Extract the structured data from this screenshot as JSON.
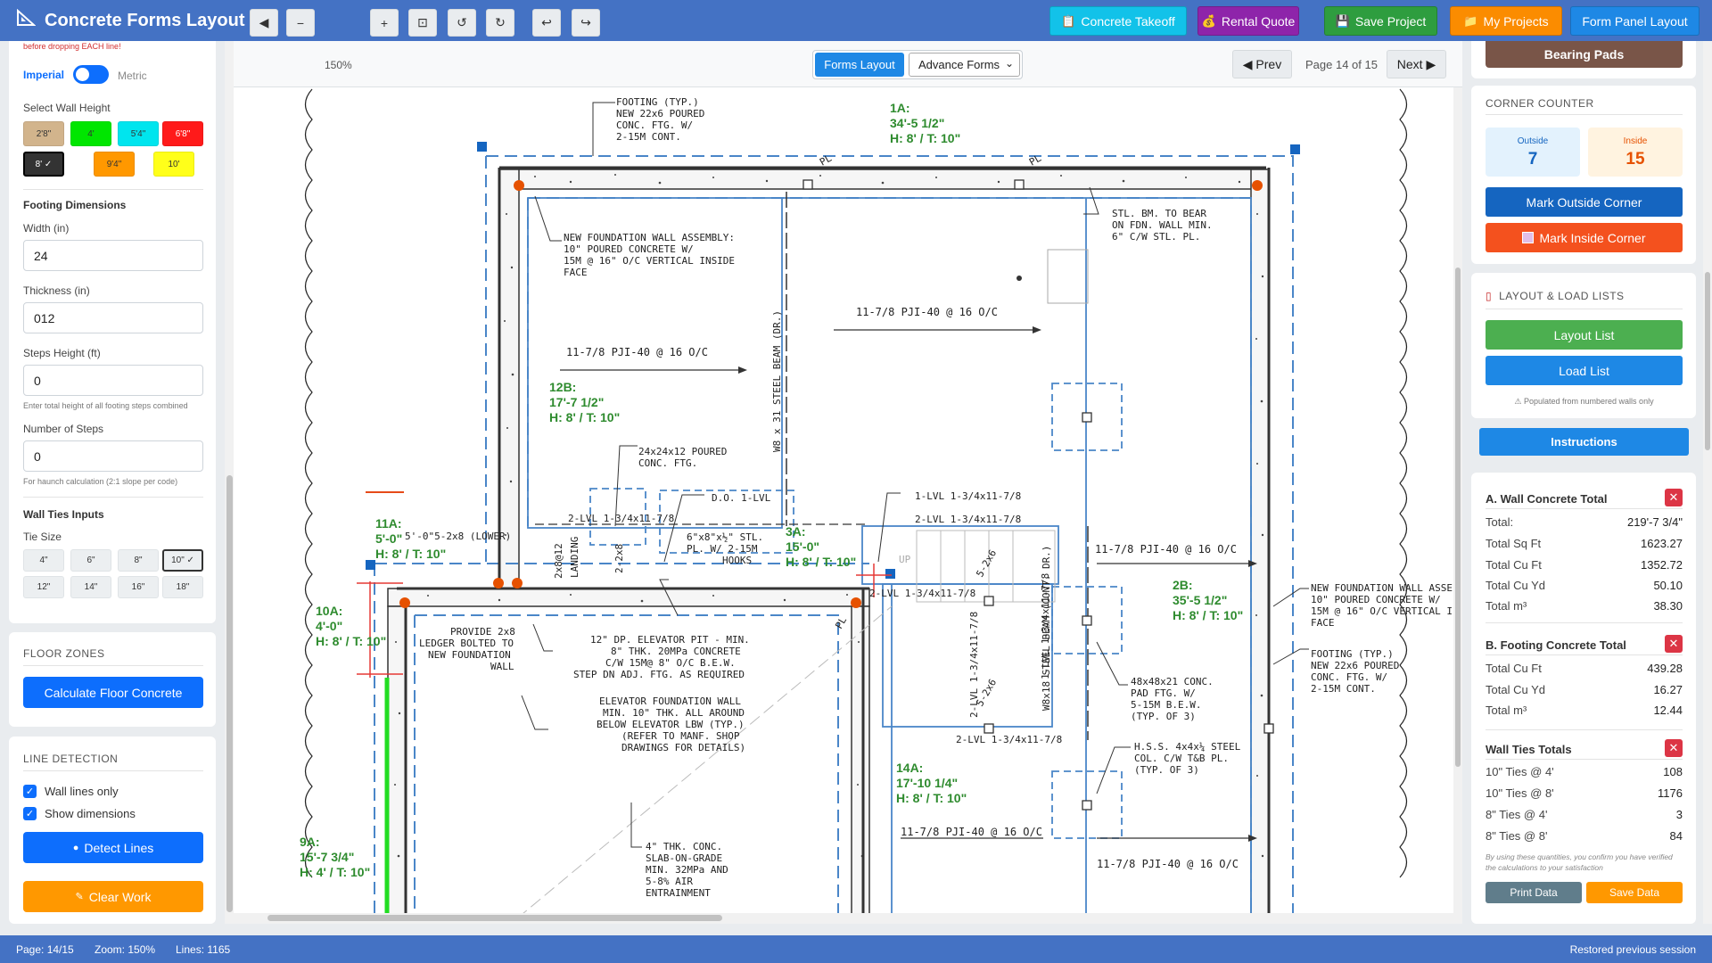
{
  "header": {
    "title": "Concrete Forms Layout",
    "buttons": [
      {
        "label": "Concrete Takeoff",
        "icon": "clipboard-icon",
        "color": "#12c2e9"
      },
      {
        "label": "Rental Quote",
        "icon": "money-bag-icon",
        "color": "#8e24aa"
      },
      {
        "label": "Save Project",
        "icon": "floppy-icon",
        "color": "#2e9d3f"
      },
      {
        "label": "My Projects",
        "icon": "folder-icon",
        "color": "#fb8c00"
      },
      {
        "label": "Form Panel Layout",
        "icon": "",
        "color": "#1e88e5"
      }
    ]
  },
  "left": {
    "warning": "before dropping EACH line!",
    "units": {
      "imperial": "Imperial",
      "metric": "Metric"
    },
    "wall_height_label": "Select Wall Height",
    "wall_heights": [
      {
        "label": "2'8\"",
        "color": "#d2b48c"
      },
      {
        "label": "4'",
        "color": "#00e600"
      },
      {
        "label": "5'4\"",
        "color": "#00e5ee"
      },
      {
        "label": "6'8\"",
        "color": "#ff1a1a"
      },
      {
        "label": "8' ✓",
        "color": "#333333"
      },
      {
        "label": "9'4\"",
        "color": "#ff9800"
      },
      {
        "label": "10'",
        "color": "#ffff1a"
      }
    ],
    "footing_title": "Footing Dimensions",
    "width_label": "Width (in)",
    "width_value": "24",
    "thickness_label": "Thickness (in)",
    "thickness_value": "012",
    "steps_height_label": "Steps Height (ft)",
    "steps_height_value": "0",
    "steps_height_hint": "Enter total height of all footing steps combined",
    "num_steps_label": "Number of Steps",
    "num_steps_value": "0",
    "num_steps_hint": "For haunch calculation (2:1 slope per code)",
    "wall_ties_title": "Wall Ties Inputs",
    "tie_size_label": "Tie Size",
    "tie_sizes": [
      "4\"",
      "6\"",
      "8\"",
      "10\" ✓",
      "12\"",
      "14\"",
      "16\"",
      "18\""
    ],
    "floor_zones_title": "FLOOR ZONES",
    "calc_floor_label": "Calculate Floor Concrete",
    "line_detection_title": "LINE DETECTION",
    "wall_lines_only": "Wall lines only",
    "show_dimensions": "Show dimensions",
    "detect_lines_label": "Detect Lines",
    "clear_work_label": "Clear Work"
  },
  "toolbar": {
    "zoom_label": "150%",
    "forms_layout_label": "Forms Layout",
    "advance_forms_label": "Advance Forms",
    "prev_label": "◀ Prev",
    "page_label": "Page 14 of 15",
    "next_label": "Next ▶"
  },
  "drawing": {
    "notes": [
      "FOOTING (TYP.)",
      "NEW 22x6 POURED",
      "CONC. FTG. W/",
      "2-15M CONT.",
      "NEW FOUNDATION WALL ASSEMBLY:",
      "10\" POURED CONCRETE W/",
      "15M @ 16\" O/C VERTICAL INSIDE",
      "FACE",
      "11-7/8 PJI-40 @ 16 O/C",
      "STL. BM. TO BEAR",
      "ON FDN. WALL MIN.",
      "6\" C/W STL. PL.",
      "24x24x12 POURED",
      "CONC. FTG.",
      "D.O. 1-LVL",
      "2-LVL 1-3/4x11-7/8",
      "6\"x8\"x½\" STL.",
      "PL. W/ 2-15M",
      "HOOKS",
      "1-LVL 1-3/4x11-7/8",
      "2-LVL 1-3/4x11-7/8",
      "PROVIDE 2x8",
      "LEDGER BOLTED TO",
      "NEW FOUNDATION",
      "WALL",
      "12\" DP. ELEVATOR PIT - MIN.",
      "8\" THK. 20MPa CONCRETE",
      "C/W 15M@ 8\" O/C B.E.W.",
      "STEP DN ADJ. FTG. AS REQUIRED",
      "ELEVATOR FOUNDATION WALL",
      "MIN. 10\" THK. ALL AROUND",
      "BELOW ELEVATOR LBW (TYP.)",
      "(REFER TO MANF. SHOP",
      "DRAWINGS FOR DETAILS)",
      "48x48x21 CONC.",
      "PAD FTG. W/",
      "5-15M B.E.W.",
      "(TYP. OF 3)",
      "H.S.S. 4x4x¼ STEEL",
      "COL. C/W T&B PL.",
      "(TYP. OF 3)",
      "4\" THK. CONC.",
      "SLAB-ON-GRADE",
      "MIN. 32MPa AND",
      "5-8% AIR",
      "ENTRAINMENT",
      "NEW FOUNDATION WALL ASSE",
      "10\" POURED CONCRETE W/",
      "15M @ 16\" O/C VERTICAL I",
      "FACE",
      "FOOTING (TYP.)",
      "NEW 22x6 POURED",
      "CONC. FTG. W/",
      "2-15M CONT.",
      "W8 x 31 STEEL BEAM (DR.)",
      "W8x18 STEEL BEAM (CONT. DR.)",
      "1-LVL 1-3/4x11-7/8",
      "2-LVL 1-3/4x11-7/8",
      "5-2x6",
      "2x8@12",
      "LANDING",
      "2-2x8",
      "5'-0\"5-2x8 (LOWER)",
      "UP",
      "PL"
    ],
    "walls": [
      [
        "1A:",
        "34'-5 1/2\"",
        "H: 8' / T: 10\""
      ],
      [
        "12B:",
        "17'-7 1/2\"",
        "H: 8' / T: 10\""
      ],
      [
        "11A:",
        "5'-0\"",
        "H: 8' / T: 10\""
      ],
      [
        "3A:",
        "15'-0\"",
        "H: 8' / T: 10\""
      ],
      [
        "2B:",
        "35'-5 1/2\"",
        "H: 8' / T: 10\""
      ],
      [
        "10A:",
        "4'-0\"",
        "H: 8' / T: 10\""
      ],
      [
        "14A:",
        "17'-10 1/4\"",
        "H: 8' / T: 10\""
      ],
      [
        "9A:",
        "15'-7 3/4\"",
        "H: 4' / T: 10\""
      ]
    ]
  },
  "right": {
    "bearing_pads_label": "Bearing Pads",
    "corner_counter_title": "CORNER COUNTER",
    "outside_label": "Outside",
    "outside_value": "7",
    "inside_label": "Inside",
    "inside_value": "15",
    "mark_outside_label": "Mark Outside Corner",
    "mark_inside_label": "Mark Inside Corner",
    "lists_title": "LAYOUT & LOAD LISTS",
    "layout_list_label": "Layout List",
    "load_list_label": "Load List",
    "lists_note": "⚠ Populated from numbered walls only",
    "instructions_label": "Instructions",
    "wall_concrete": {
      "title": "A. Wall Concrete Total",
      "rows": [
        {
          "k": "Total:",
          "v": "219'-7 3/4\""
        },
        {
          "k": "Total Sq Ft",
          "v": "1623.27"
        },
        {
          "k": "Total Cu Ft",
          "v": "1352.72"
        },
        {
          "k": "Total Cu Yd",
          "v": "50.10"
        },
        {
          "k": "Total m³",
          "v": "38.30"
        }
      ]
    },
    "footing_concrete": {
      "title": "B. Footing Concrete Total",
      "rows": [
        {
          "k": "Total Cu Ft",
          "v": "439.28"
        },
        {
          "k": "Total Cu Yd",
          "v": "16.27"
        },
        {
          "k": "Total m³",
          "v": "12.44"
        }
      ]
    },
    "wall_ties": {
      "title": "Wall Ties Totals",
      "rows": [
        {
          "k": "10\" Ties @ 4'",
          "v": "108"
        },
        {
          "k": "10\" Ties @ 8'",
          "v": "1176"
        },
        {
          "k": "8\" Ties @ 4'",
          "v": "3"
        },
        {
          "k": "8\" Ties @ 8'",
          "v": "84"
        }
      ]
    },
    "disclaimer": "By using these quantities, you confirm you have verified the calculations to your satisfaction",
    "print_label": "Print Data",
    "save_label": "Save Data"
  },
  "status": {
    "page": "Page: 14/15",
    "zoom": "Zoom: 150%",
    "lines": "Lines: 1165",
    "session": "Restored previous session"
  }
}
